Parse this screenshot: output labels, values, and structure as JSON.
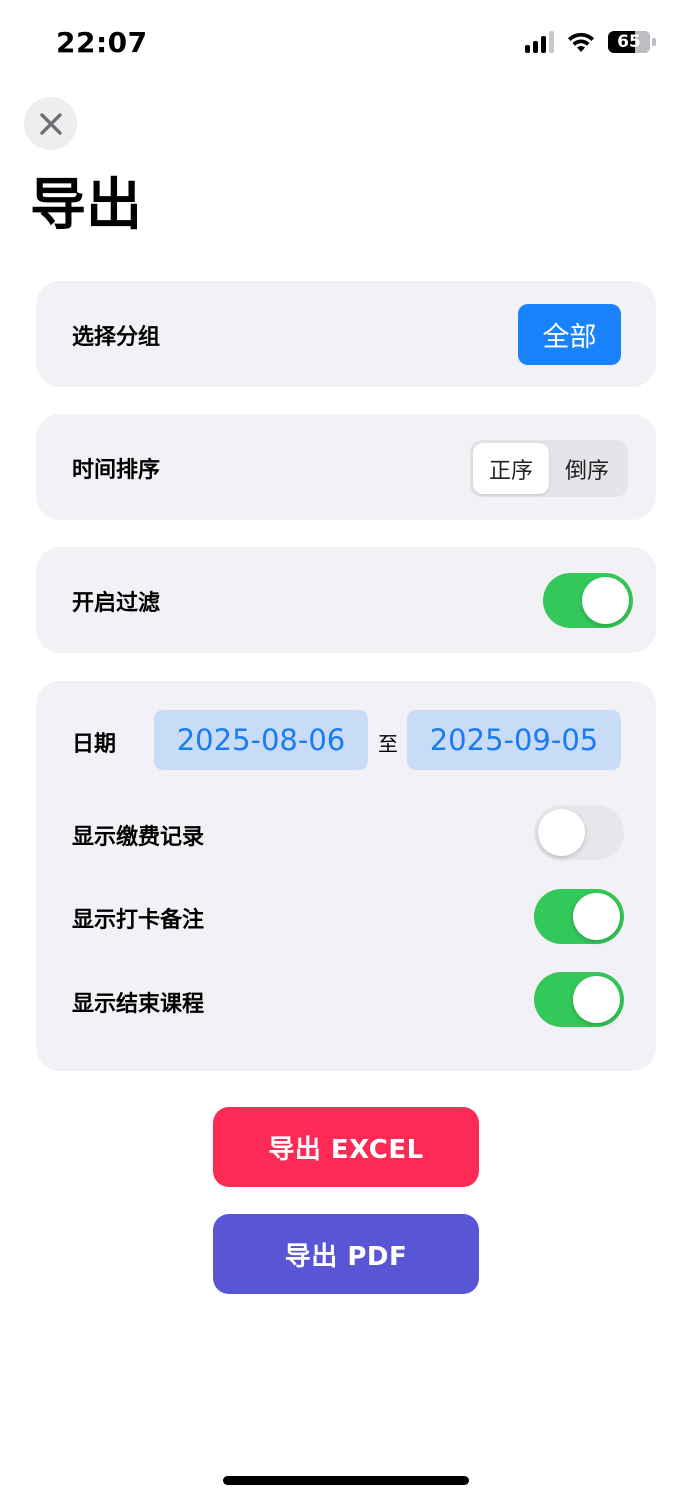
{
  "status_bar": {
    "time": "22:07",
    "battery_level": "65"
  },
  "header": {
    "title": "导出"
  },
  "group": {
    "label": "选择分组",
    "value": "全部"
  },
  "sort": {
    "label": "时间排序",
    "options": [
      "正序",
      "倒序"
    ],
    "selected": "正序"
  },
  "filter": {
    "label": "开启过滤",
    "enabled": true
  },
  "date_range": {
    "label": "日期",
    "start": "2025-08-06",
    "separator": "至",
    "end": "2025-09-05"
  },
  "options": [
    {
      "label": "显示缴费记录",
      "enabled": false
    },
    {
      "label": "显示打卡备注",
      "enabled": true
    },
    {
      "label": "显示结束课程",
      "enabled": true
    }
  ],
  "actions": {
    "export_excel": "导出 EXCEL",
    "export_pdf": "导出 PDF"
  },
  "colors": {
    "accent_blue": "#1a82fb",
    "toggle_on": "#34c759",
    "excel_button": "#fe2a56",
    "pdf_button": "#5956d6",
    "card_background": "#f2f1f6"
  },
  "icons": {
    "close": "close-icon",
    "signal": "cellular-signal-icon",
    "wifi": "wifi-icon",
    "battery": "battery-icon"
  }
}
